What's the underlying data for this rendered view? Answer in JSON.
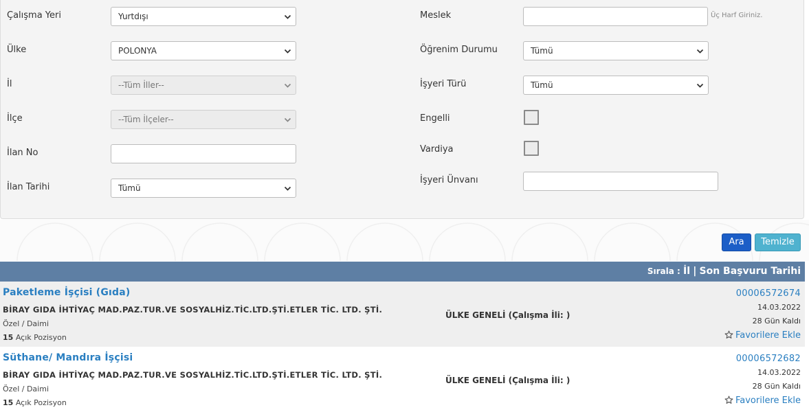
{
  "filters": {
    "calisma_yeri": {
      "label": "Çalışma Yeri",
      "value": "Yurtdışı"
    },
    "ulke": {
      "label": "Ülke",
      "value": "POLONYA"
    },
    "il": {
      "label": "İl",
      "value": "--Tüm İller--"
    },
    "ilce": {
      "label": "İlçe",
      "value": "--Tüm İlçeler--"
    },
    "ilan_no": {
      "label": "İlan No",
      "value": ""
    },
    "ilan_tarihi": {
      "label": "İlan Tarihi",
      "value": "Tümü"
    },
    "meslek": {
      "label": "Meslek",
      "value": "",
      "hint": "Üç Harf Giriniz."
    },
    "ogrenim_durumu": {
      "label": "Öğrenim Durumu",
      "value": "Tümü"
    },
    "isyeri_turu": {
      "label": "İşyeri Türü",
      "value": "Tümü"
    },
    "engelli": {
      "label": "Engelli",
      "checked": false
    },
    "vardiya": {
      "label": "Vardiya",
      "checked": false
    },
    "isyeri_unvani": {
      "label": "İşyeri Ünvanı",
      "value": ""
    }
  },
  "buttons": {
    "search": "Ara",
    "clear": "Temizle"
  },
  "sort": {
    "prefix": "Sırala :",
    "option1": "İl",
    "separator": "|",
    "option2": "Son Başvuru Tarihi"
  },
  "jobs": [
    {
      "title": "Paketleme İşçisi (Gıda)",
      "company": "BİRAY GIDA İHTİYAÇ MAD.PAZ.TUR.VE SOSYALHİZ.TİC.LTD.ŞTİ.ETLER TİC. LTD. ŞTİ.",
      "type": "Özel / Daimi",
      "positions_count": "15",
      "positions_label": "Açık Pozisyon",
      "location": "ÜLKE GENELİ (Çalışma İli: )",
      "listing_no": "00006572674",
      "date": "14.03.2022",
      "days_left": "28 Gün Kaldı",
      "favorite_label": "Favorilere Ekle"
    },
    {
      "title": "Süthane/ Mandıra İşçisi",
      "company": "BİRAY GIDA İHTİYAÇ MAD.PAZ.TUR.VE SOSYALHİZ.TİC.LTD.ŞTİ.ETLER TİC. LTD. ŞTİ.",
      "type": "Özel / Daimi",
      "positions_count": "15",
      "positions_label": "Açık Pozisyon",
      "location": "ÜLKE GENELİ (Çalışma İli: )",
      "listing_no": "00006572682",
      "date": "14.03.2022",
      "days_left": "28 Gün Kaldı",
      "favorite_label": "Favorilere Ekle"
    }
  ],
  "colors": {
    "link": "#2a7fc1",
    "sort_bar": "#5e7fa4",
    "search_button": "#1c5ec7",
    "clear_button": "#4fb2cf"
  }
}
